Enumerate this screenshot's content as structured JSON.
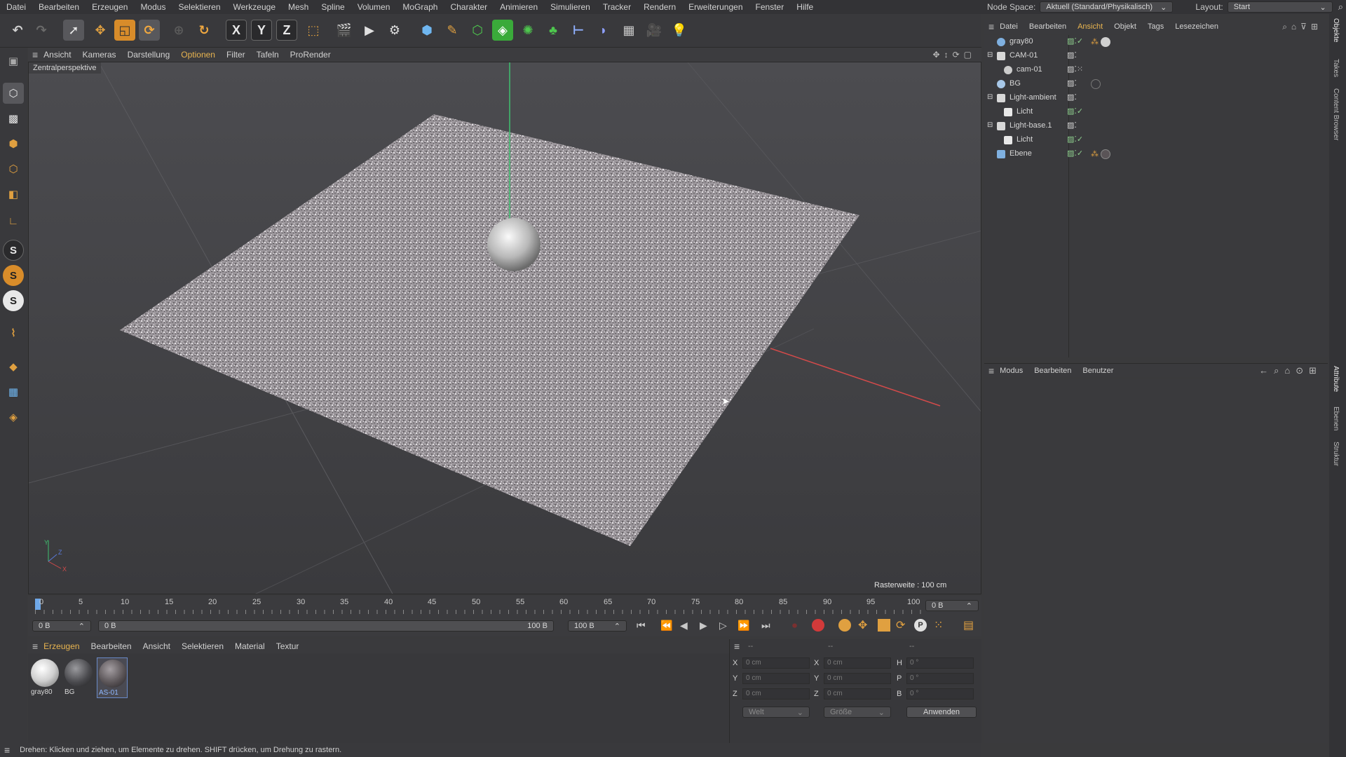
{
  "menu": [
    "Datei",
    "Bearbeiten",
    "Erzeugen",
    "Modus",
    "Selektieren",
    "Werkzeuge",
    "Mesh",
    "Spline",
    "Volumen",
    "MoGraph",
    "Charakter",
    "Animieren",
    "Simulieren",
    "Tracker",
    "Rendern",
    "Erweiterungen",
    "Fenster",
    "Hilfe"
  ],
  "node_space": {
    "label": "Node Space:",
    "value": "Aktuell (Standard/Physikalisch)"
  },
  "layout": {
    "label": "Layout:",
    "value": "Start"
  },
  "toolbar": {
    "x_label": "X",
    "y_label": "Y",
    "z_label": "Z"
  },
  "left_tools": {
    "s1": "S",
    "s2": "S",
    "s3": "S"
  },
  "viewport": {
    "menu": [
      "Ansicht",
      "Kameras",
      "Darstellung",
      "Optionen",
      "Filter",
      "Tafeln",
      "ProRender"
    ],
    "active_menu": "Optionen",
    "camera_label": "Zentralperspektive",
    "grid_info": "Rasterweite : 100 cm",
    "axis_y": "Y",
    "axis_z": "Z",
    "axis_x": "X"
  },
  "timeline": {
    "ticks": [
      "0",
      "5",
      "10",
      "15",
      "20",
      "25",
      "30",
      "35",
      "40",
      "45",
      "50",
      "55",
      "60",
      "65",
      "70",
      "75",
      "80",
      "85",
      "90",
      "95",
      "100"
    ],
    "current_frame": "0 B",
    "start": "0 B",
    "range_start": "0 B",
    "range_end": "100 B",
    "end": "100 B",
    "p_label": "P"
  },
  "material_manager": {
    "menu": [
      "Erzeugen",
      "Bearbeiten",
      "Ansicht",
      "Selektieren",
      "Material",
      "Textur"
    ],
    "active_menu": "Erzeugen",
    "materials": [
      {
        "name": "gray80",
        "color": "#cfcfcf"
      },
      {
        "name": "BG",
        "color": "#4a4a4e"
      },
      {
        "name": "AS-01",
        "color": "#5a5457"
      }
    ]
  },
  "coords": {
    "header": [
      "--",
      "--",
      "--"
    ],
    "rows": [
      {
        "a": "X",
        "av": "0 cm",
        "b": "X",
        "bv": "0 cm",
        "c": "H",
        "cv": "0 °"
      },
      {
        "a": "Y",
        "av": "0 cm",
        "b": "Y",
        "bv": "0 cm",
        "c": "P",
        "cv": "0 °"
      },
      {
        "a": "Z",
        "av": "0 cm",
        "b": "Z",
        "bv": "0 cm",
        "c": "B",
        "cv": "0 °"
      }
    ],
    "space": "Welt",
    "mode": "Größe",
    "apply": "Anwenden"
  },
  "status": "Drehen: Klicken und ziehen, um Elemente zu drehen. SHIFT drücken, um Drehung zu rastern.",
  "object_manager": {
    "menu": [
      "Datei",
      "Bearbeiten",
      "Ansicht",
      "Objekt",
      "Tags",
      "Lesezeichen"
    ],
    "active_menu": "Ansicht",
    "objects": [
      {
        "name": "gray80",
        "indent": 0,
        "icon": "#7fb0e0"
      },
      {
        "name": "CAM-01",
        "indent": 0,
        "icon": "#d8d8d8"
      },
      {
        "name": "cam-01",
        "indent": 1,
        "icon": "#cccccc"
      },
      {
        "name": "BG",
        "indent": 0,
        "icon": "#a8c8e8"
      },
      {
        "name": "Light-ambient",
        "indent": 0,
        "icon": "#d8d8d8"
      },
      {
        "name": "Licht",
        "indent": 1,
        "icon": "#e8e8e8"
      },
      {
        "name": "Light-base.1",
        "indent": 0,
        "icon": "#d8d8d8"
      },
      {
        "name": "Licht",
        "indent": 1,
        "icon": "#e8e8e8"
      },
      {
        "name": "Ebene",
        "indent": 0,
        "icon": "#7fb0e0"
      }
    ]
  },
  "attributes": {
    "menu": [
      "Modus",
      "Bearbeiten",
      "Benutzer"
    ]
  },
  "right_tabs": [
    "Objekte",
    "Takes",
    "Content Browser",
    "Attribute",
    "Ebenen",
    "Struktur"
  ]
}
